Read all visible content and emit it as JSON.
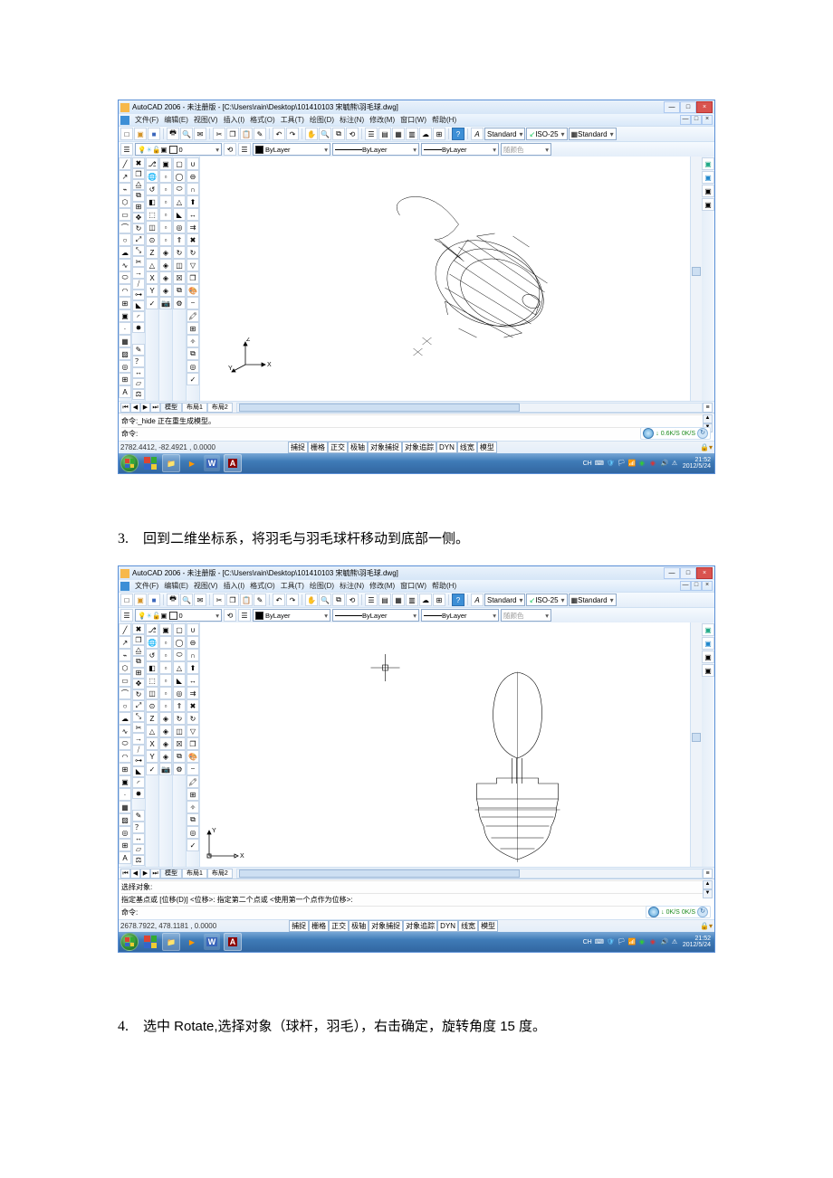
{
  "titlebar": {
    "app_title": "AutoCAD 2006 - 未注册版 - [C:\\Users\\rain\\Desktop\\101410103 宋毓熊\\羽毛球.dwg]",
    "min": "—",
    "max": "□",
    "close": "×"
  },
  "menu": {
    "logo": "",
    "items": [
      "文件(F)",
      "编辑(E)",
      "视图(V)",
      "插入(I)",
      "格式(O)",
      "工具(T)",
      "绘图(D)",
      "标注(N)",
      "修改(M)",
      "窗口(W)",
      "帮助(H)"
    ],
    "mctrl": [
      "—",
      "□",
      "×"
    ]
  },
  "std_toolbar": {
    "style_sel1": "Standard",
    "style_sel2": "ISO-25",
    "style_sel3": "Standard"
  },
  "layer_bar": {
    "layer_name": "0",
    "bylayer": "ByLayer",
    "color_label": "随颜色"
  },
  "layout_tabs": {
    "model": "模型",
    "layout1": "布局1",
    "layout2": "布局2"
  },
  "commands1": {
    "line1_label": "命令:",
    "line1_text": " _hide 正在重生成模型。",
    "line2_label": "命令:"
  },
  "commands2": {
    "line1": "选择对象:",
    "line2": "指定基点或 [位移(D)] <位移>:   指定第二个点或 <使用第一个点作为位移>:",
    "line3_label": "命令:"
  },
  "status1_coords": "2782.4412, -82.4921 , 0.0000",
  "status2_coords": "2678.7922, 478.1181 , 0.0000",
  "status_btns": [
    "捕捉",
    "栅格",
    "正交",
    "极轴",
    "对象捕捉",
    "对象追踪",
    "DYN",
    "线宽",
    "模型"
  ],
  "net1": {
    "down": "↓",
    "dv": "0.6K/S",
    "uv": "0K/S"
  },
  "net2": {
    "down": "↓",
    "dv": "0K/S",
    "uv": "0K/S"
  },
  "ucs3d": {
    "x": "X",
    "y": "Y",
    "z": "Z"
  },
  "ucs2d": {
    "x": "X",
    "y": "Y"
  },
  "clock": {
    "time": "21:52",
    "date": "2012/5/24"
  },
  "clock2": {
    "time": "21:52",
    "date": "2012/5/24"
  },
  "step3": "回到二维坐标系，将羽毛与羽毛球杆移动到底部一侧。",
  "step3_num": "3.",
  "step4": "选中 Rotate,选择对象（球杆，羽毛），右击确定，旋转角度 15 度。",
  "step4_num": "4."
}
